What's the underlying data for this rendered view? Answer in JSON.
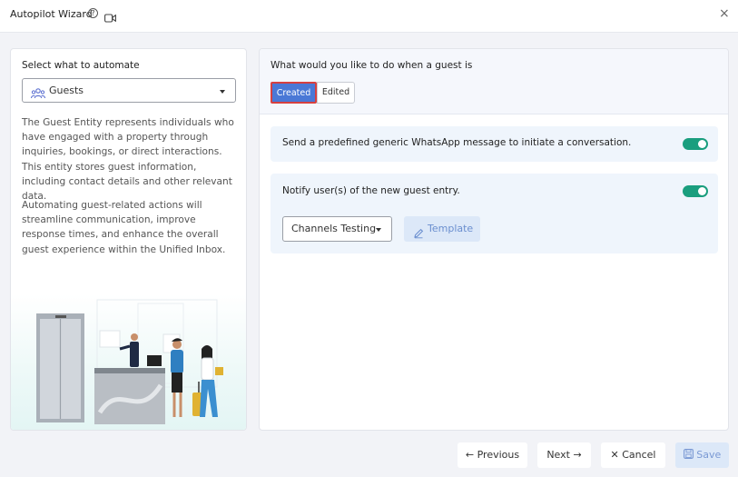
{
  "window": {
    "title": "Autopilot Wizard",
    "help_glyph": "?",
    "close_glyph": "×"
  },
  "left": {
    "label": "Select what to automate",
    "select_value": "Guests",
    "description_1": "The Guest Entity represents individuals who have engaged with a property through inquiries, bookings, or direct interactions. This entity stores guest information, including contact details and other relevant data.",
    "description_2": "Automating guest-related actions will streamline communication, improve response times, and enhance the overall guest experience within the Unified Inbox."
  },
  "right": {
    "question": "What would you like to do when a guest is",
    "tabs": [
      {
        "label": "Created",
        "active": true
      },
      {
        "label": "Edited",
        "active": false
      }
    ],
    "actions": [
      {
        "text": "Send a predefined generic WhatsApp message to initiate a conversation.",
        "enabled": true
      },
      {
        "text": "Notify user(s) of the new guest entry.",
        "enabled": true,
        "channel_label": "Channels Testing",
        "template_label": "Template"
      }
    ]
  },
  "footer": {
    "previous_label": "Previous",
    "previous_glyph": "←",
    "next_label": "Next",
    "next_glyph": "→",
    "cancel_label": "Cancel",
    "cancel_glyph": "✕",
    "save_label": "Save"
  },
  "colors": {
    "accent": "#4a78d6",
    "toggle_on": "#1a9e7e",
    "panel_bg": "#eff5fc",
    "highlight_border": "#d64040"
  }
}
